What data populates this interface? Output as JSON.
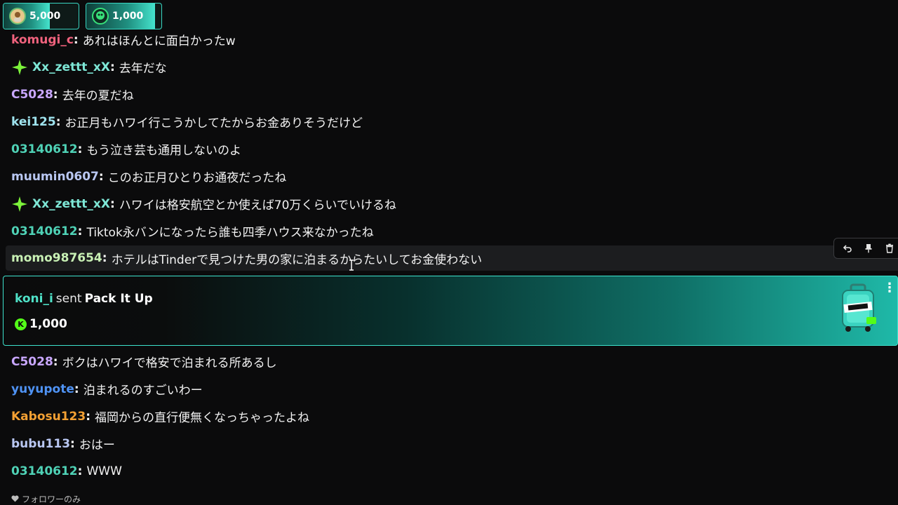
{
  "top_gifts": [
    {
      "amount": "5,000",
      "fill": 0.62,
      "avatar_icon": "user-avatar-icon"
    },
    {
      "amount": "1,000",
      "fill": 0.92,
      "avatar_icon": "user-avatar-icon"
    }
  ],
  "messages_top": [
    {
      "user": "komugi_c",
      "color": "#f0627d",
      "text": "あれはほんとに面白かったw",
      "badge": false
    },
    {
      "user": "Xx_zettt_xX",
      "color": "#7ee7d6",
      "text": "去年だな",
      "badge": true
    },
    {
      "user": "C5028",
      "color": "#c9a7ff",
      "text": "去年の夏だね",
      "badge": false
    },
    {
      "user": "kei125",
      "color": "#9fe3ee",
      "text": "お正月もハワイ行こうかしてたからお金ありそうだけど",
      "badge": false
    },
    {
      "user": "03140612",
      "color": "#4fd2b6",
      "text": "もう泣き芸も通用しないのよ",
      "badge": false
    },
    {
      "user": "muumin0607",
      "color": "#b9c7f2",
      "text": "このお正月ひとりお通夜だったね",
      "badge": false
    },
    {
      "user": "Xx_zettt_xX",
      "color": "#7ee7d6",
      "text": "ハワイは格安航空とか使えば70万くらいでいけるね",
      "badge": true
    },
    {
      "user": "03140612",
      "color": "#4fd2b6",
      "text": "Tiktok永バンになったら誰も四季ハウス来なかったね",
      "badge": false
    }
  ],
  "hovered_message": {
    "user": "momo987654",
    "color": "#c8f0b4",
    "text": "ホテルはTinderで見つけた男の家に泊まるからたいしてお金使わない"
  },
  "gift_card": {
    "user": "koni_i",
    "verb": "sent",
    "gift_name": "Pack It Up",
    "amount": "1,000",
    "coin_glyph": "K",
    "accent": "#3ee3cd"
  },
  "messages_bottom": [
    {
      "user": "C5028",
      "color": "#c9a7ff",
      "text": "ボクはハワイで格安で泊まれる所あるし"
    },
    {
      "user": "yuyupote",
      "color": "#4f93f5",
      "text": "泊まれるのすごいわー"
    },
    {
      "user": "Kabosu123",
      "color": "#f3a033",
      "text": "福岡からの直行便無くなっちゃったよね"
    },
    {
      "user": "bubu113",
      "color": "#b9c7f2",
      "text": "おはー"
    },
    {
      "user": "03140612",
      "color": "#4fd2b6",
      "text": "WWW"
    }
  ],
  "footer": {
    "label": "フォロワーのみ",
    "icon": "heart-icon"
  },
  "message_actions": [
    "reply-icon",
    "pin-icon",
    "delete-icon"
  ]
}
